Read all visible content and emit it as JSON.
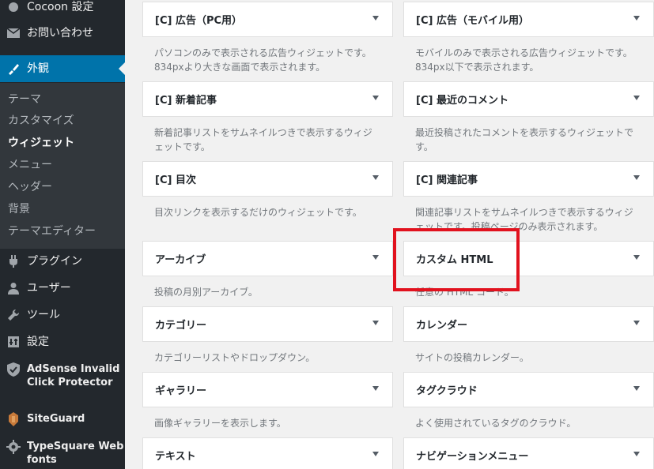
{
  "sidebar": {
    "menu": [
      {
        "label": "Cocoon 設定",
        "icon": "circle-icon"
      },
      {
        "label": "お問い合わせ",
        "icon": "mail-icon"
      },
      {
        "label": "外観",
        "icon": "paintbrush-icon"
      },
      {
        "label": "プラグイン",
        "icon": "plugin-icon"
      },
      {
        "label": "ユーザー",
        "icon": "user-icon"
      },
      {
        "label": "ツール",
        "icon": "wrench-icon"
      },
      {
        "label": "設定",
        "icon": "settings-icon"
      },
      {
        "label": "AdSense Invalid Click Protector",
        "icon": "shield-icon"
      },
      {
        "label": "SiteGuard",
        "icon": "siteguard-icon"
      },
      {
        "label": "TypeSquare Webfonts",
        "icon": "gear-icon"
      }
    ],
    "submenu": [
      "テーマ",
      "カスタマイズ",
      "ウィジェット",
      "メニュー",
      "ヘッダー",
      "背景",
      "テーマエディター"
    ],
    "current_submenu": "ウィジェット"
  },
  "widgets": [
    {
      "title": "[C] 広告（PC用）",
      "desc": "パソコンのみで表示される広告ウィジェットです。834pxより大きな画面で表示されます。"
    },
    {
      "title": "[C] 広告（モバイル用）",
      "desc": "モバイルのみで表示される広告ウィジェットです。834px以下で表示されます。"
    },
    {
      "title": "[C] 新着記事",
      "desc": "新着記事リストをサムネイルつきで表示するウィジェットです。"
    },
    {
      "title": "[C] 最近のコメント",
      "desc": "最近投稿されたコメントを表示するウィジェットです。"
    },
    {
      "title": "[C] 目次",
      "desc": "目次リンクを表示するだけのウィジェットです。"
    },
    {
      "title": "[C] 関連記事",
      "desc": "関連記事リストをサムネイルつきで表示するウィジェットです。投稿ページのみ表示されます。"
    },
    {
      "title": "アーカイブ",
      "desc": "投稿の月別アーカイブ。"
    },
    {
      "title": "カスタム HTML",
      "desc": "任意の HTML コード。"
    },
    {
      "title": "カテゴリー",
      "desc": "カテゴリーリストやドロップダウン。"
    },
    {
      "title": "カレンダー",
      "desc": "サイトの投稿カレンダー。"
    },
    {
      "title": "ギャラリー",
      "desc": "画像ギャラリーを表示します。"
    },
    {
      "title": "タグクラウド",
      "desc": "よく使用されているタグのクラウド。"
    },
    {
      "title": "テキスト",
      "desc": ""
    },
    {
      "title": "ナビゲーションメニュー",
      "desc": ""
    }
  ],
  "colors": {
    "sidebar_bg": "#23282d",
    "submenu_bg": "#32373c",
    "active_menu": "#0073aa",
    "highlight": "#e1121e"
  }
}
